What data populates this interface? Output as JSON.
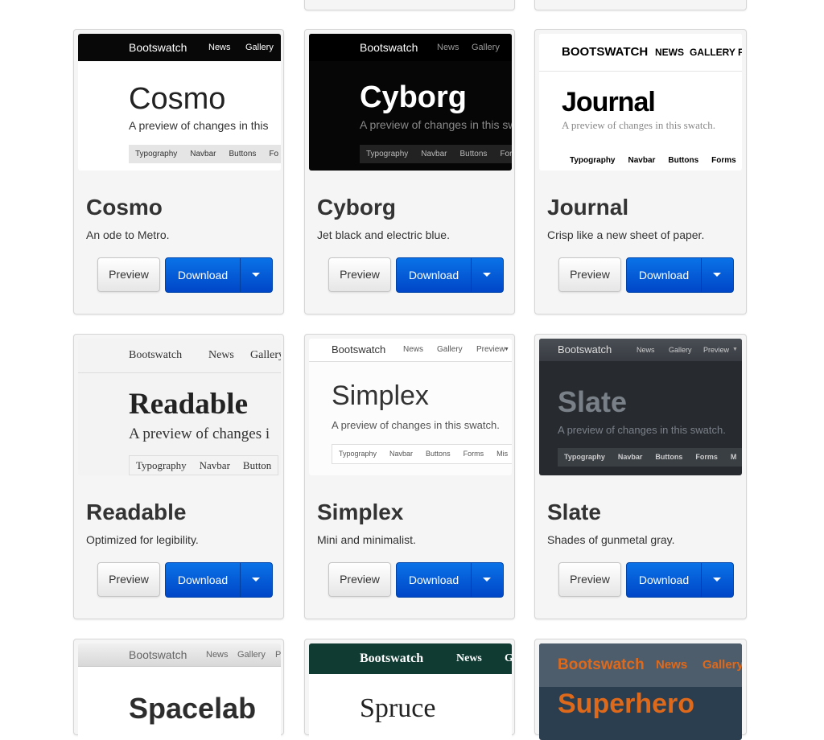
{
  "ui": {
    "preview_label": "Preview",
    "download_label": "Download",
    "caret_icon": "caret-down-icon"
  },
  "cards": {
    "cosmo": {
      "title": "Cosmo",
      "desc": "An ode to Metro.",
      "thumb": {
        "brand": "Bootswatch",
        "nav": [
          "News",
          "Gallery"
        ],
        "heading": "Cosmo",
        "sub": "A preview of changes in this",
        "tabs": [
          "Typography",
          "Navbar",
          "Buttons",
          "Fo"
        ]
      }
    },
    "cyborg": {
      "title": "Cyborg",
      "desc": "Jet black and electric blue.",
      "thumb": {
        "brand": "Bootswatch",
        "nav": [
          "News",
          "Gallery"
        ],
        "heading": "Cyborg",
        "sub": "A preview of changes in this sw",
        "tabs": [
          "Typography",
          "Navbar",
          "Buttons",
          "Form"
        ]
      }
    },
    "journal": {
      "title": "Journal",
      "desc": "Crisp like a new sheet of paper.",
      "thumb": {
        "brand": "BOOTSWATCH",
        "nav": [
          "NEWS",
          "GALLERY",
          "F"
        ],
        "heading": "Journal",
        "sub": "A preview of changes in this swatch.",
        "tabs": [
          "Typography",
          "Navbar",
          "Buttons",
          "Forms"
        ]
      }
    },
    "readable": {
      "title": "Readable",
      "desc": "Optimized for legibility.",
      "thumb": {
        "brand": "Bootswatch",
        "nav": [
          "News",
          "Gallery"
        ],
        "heading": "Readable",
        "sub": "A preview of changes i",
        "tabs": [
          "Typography",
          "Navbar",
          "Button"
        ]
      }
    },
    "simplex": {
      "title": "Simplex",
      "desc": "Mini and minimalist.",
      "thumb": {
        "brand": "Bootswatch",
        "nav": [
          "News",
          "Gallery",
          "Preview"
        ],
        "heading": "Simplex",
        "sub": "A preview of changes in this swatch.",
        "tabs": [
          "Typography",
          "Navbar",
          "Buttons",
          "Forms",
          "Mis"
        ]
      }
    },
    "slate": {
      "title": "Slate",
      "desc": "Shades of gunmetal gray.",
      "thumb": {
        "brand": "Bootswatch",
        "nav": [
          "News",
          "Gallery",
          "Preview"
        ],
        "heading": "Slate",
        "sub": "A preview of changes in this swatch.",
        "tabs": [
          "Typography",
          "Navbar",
          "Buttons",
          "Forms",
          "M"
        ]
      }
    },
    "spacelab": {
      "thumb": {
        "brand": "Bootswatch",
        "nav": [
          "News",
          "Gallery",
          "P"
        ],
        "heading": "Spacelab"
      }
    },
    "spruce": {
      "thumb": {
        "brand": "Bootswatch",
        "nav": [
          "News",
          "G"
        ],
        "heading": "Spruce"
      }
    },
    "superhero": {
      "thumb": {
        "brand": "Bootswatch",
        "nav": [
          "News",
          "Gallery"
        ],
        "heading": "Superhero"
      }
    }
  }
}
